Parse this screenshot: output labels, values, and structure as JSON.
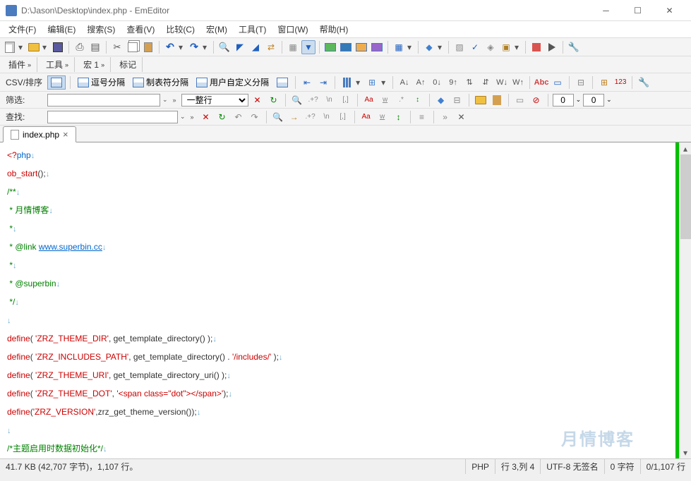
{
  "window": {
    "title": "D:\\Jason\\Desktop\\index.php - EmEditor"
  },
  "menu": {
    "file": "文件(F)",
    "edit": "编辑(E)",
    "search": "搜索(S)",
    "view": "查看(V)",
    "compare": "比较(C)",
    "macro": "宏(M)",
    "tools": "工具(T)",
    "window": "窗口(W)",
    "help": "帮助(H)"
  },
  "subtabs": {
    "plugins": "插件",
    "tools": "工具",
    "macros": "宏 1",
    "marks": "标记"
  },
  "csv": {
    "label": "CSV/排序",
    "comma": "逗号分隔",
    "tab": "制表符分隔",
    "user": "用户自定义分隔"
  },
  "filter": {
    "label": "筛选:",
    "option": "一整行",
    "num1": "0",
    "num2": "0"
  },
  "find": {
    "label": "查找:"
  },
  "tab": {
    "name": "index.php"
  },
  "code": {
    "l1a": "<?",
    "l1b": "php",
    "l2a": "ob_start",
    "l2b": "();",
    "l3": "/**",
    "l4": " * 月情博客",
    "l5": " *",
    "l6a": " * @link ",
    "l6b": "www.superbin.cc",
    "l7": " *",
    "l8": " * @superbin",
    "l9": " */",
    "l11a": "define",
    "l11b": "( ",
    "l11c": "'ZRZ_THEME_DIR'",
    "l11d": ", get_template_directory() );",
    "l12a": "define",
    "l12b": "( ",
    "l12c": "'ZRZ_INCLUDES_PATH'",
    "l12d": ", get_template_directory() . ",
    "l12e": "'/includes/'",
    "l12f": " );",
    "l13a": "define",
    "l13b": "( ",
    "l13c": "'ZRZ_THEME_URI'",
    "l13d": ", get_template_directory_uri() );",
    "l14a": "define",
    "l14b": "( ",
    "l14c": "'ZRZ_THEME_DOT'",
    "l14d": ", ",
    "l14e": "'<span class=\"dot\"></span>'",
    "l14f": ");",
    "l15a": "define",
    "l15b": "(",
    "l15c": "'ZRZ_VERSION'",
    "l15d": ",zrz_get_theme_version());",
    "l17": "/*主题启用时数据初始化*/",
    "nl": "↓"
  },
  "status": {
    "size": "41.7 KB (42,707 字节)，1,107 行。",
    "lang": "PHP",
    "pos": "行 3,列 4",
    "enc": "UTF-8 无签名",
    "chars": "0 字符",
    "lines": "0/1,107 行"
  },
  "watermark": "月情博客"
}
